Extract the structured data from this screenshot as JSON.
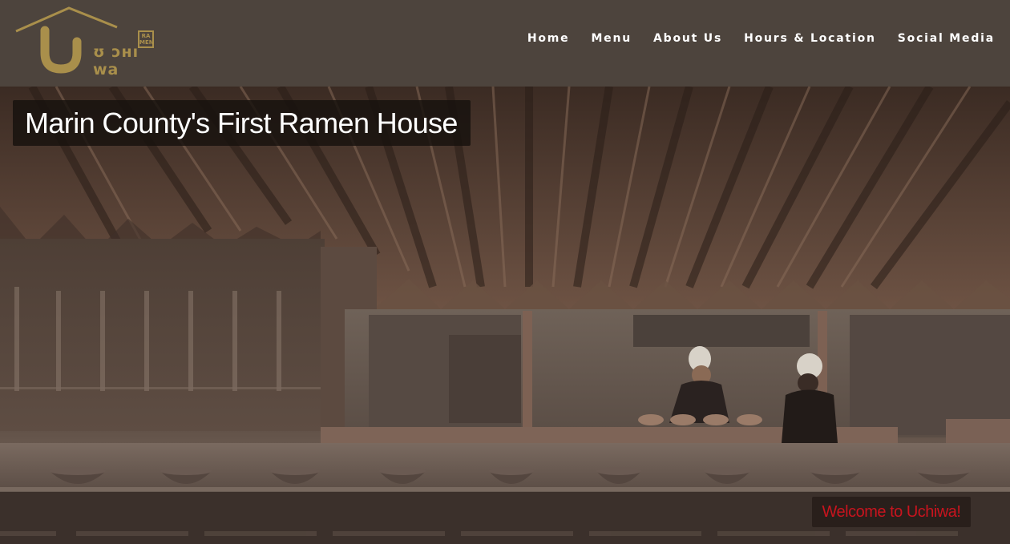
{
  "brand": {
    "logo_word": "ʊ ɔʜı wa",
    "logo_stamp": "RA MEN",
    "colors": {
      "gold": "#a98f4b",
      "header_bg": "#4d443d"
    }
  },
  "nav": {
    "items": [
      {
        "label": "Home"
      },
      {
        "label": "Menu"
      },
      {
        "label": "About Us"
      },
      {
        "label": "Hours & Location"
      },
      {
        "label": "Social Media"
      }
    ]
  },
  "hero": {
    "headline": "Marin County's First Ramen House",
    "welcome": "Welcome to Uchiwa!",
    "welcome_color": "#c8141e"
  }
}
